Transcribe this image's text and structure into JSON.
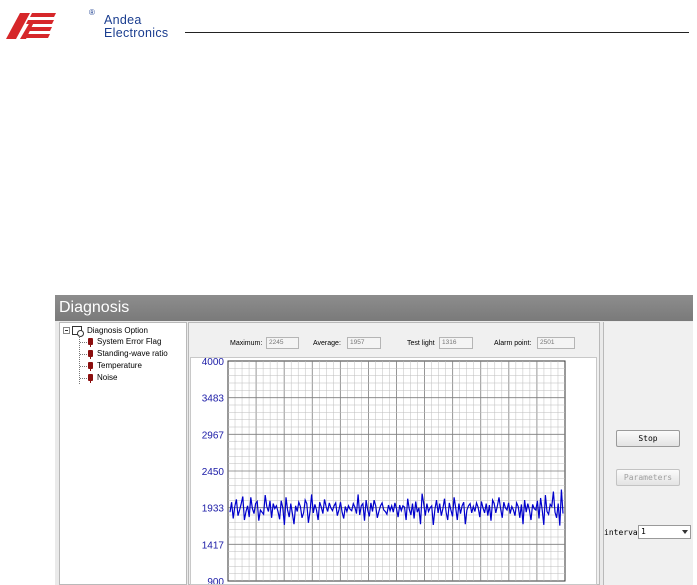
{
  "brand": {
    "line1": "Andea",
    "line2": "Electronics",
    "registered_mark": "®",
    "logo_color": "#d6272a",
    "text_color": "#1a3d8f"
  },
  "window": {
    "title": "Diagnosis"
  },
  "tree": {
    "root_label": "Diagnosis Option",
    "items": [
      {
        "label": "System Error Flag",
        "icon": "red-pin-icon"
      },
      {
        "label": "Standing-wave ratio",
        "icon": "red-pin-icon"
      },
      {
        "label": "Temperature",
        "icon": "red-pin-icon"
      },
      {
        "label": "Noise",
        "icon": "red-pin-icon"
      }
    ]
  },
  "stats": {
    "maximum_label": "Maximum:",
    "maximum_value": "2245",
    "average_label": "Average:",
    "average_value": "1957",
    "test_light_label": "Test light",
    "test_light_value": "1316",
    "alarm_point_label": "Alarm point:",
    "alarm_point_value": "2501"
  },
  "controls": {
    "stop_label": "Stop",
    "parameters_label": "Parameters",
    "interval_label": "interval",
    "interval_value": "1"
  },
  "chart_data": {
    "type": "line",
    "title": "",
    "xlabel": "",
    "ylabel": "",
    "ylim": [
      900,
      4000
    ],
    "y_ticks": [
      "4000",
      "3483",
      "2967",
      "2450",
      "1933",
      "1417",
      "900"
    ],
    "grid": true,
    "line_color": "#0000cc",
    "axis_label_color": "#1a1aa6",
    "series": [
      {
        "values": [
          1870,
          2010,
          1780,
          1950,
          2050,
          1820,
          1900,
          1990,
          2090,
          1760,
          1880,
          1960,
          1800,
          2080,
          1920,
          1850,
          1990,
          2020,
          1750,
          1900,
          1870,
          1840,
          2110,
          1950,
          1880,
          2030,
          1790,
          1990,
          1920,
          1960,
          1880,
          1770,
          2030,
          1930,
          1690,
          2080,
          1900,
          1800,
          1990,
          1850,
          1700,
          1960,
          1880,
          2010,
          1950,
          1790,
          1860,
          2040,
          1990,
          1720,
          1880,
          2120,
          1860,
          1980,
          1900,
          1760,
          2010,
          1940,
          1850,
          2050,
          1950,
          1880,
          2000,
          1930,
          1890,
          1960,
          2000,
          1820,
          1900,
          2010,
          1870,
          1780,
          1950,
          1880,
          1960,
          1910,
          1890,
          1990,
          1940,
          1850,
          2120,
          1830,
          1960,
          1990,
          1750,
          2040,
          1900,
          1810,
          2000,
          1880,
          2040,
          1960,
          1790,
          1880,
          1960,
          2000,
          1900,
          1880,
          1840,
          1970,
          1890,
          1960,
          1870,
          2000,
          1920,
          1800,
          1970,
          1890,
          1960,
          1940,
          1760,
          2060,
          1910,
          1830,
          1990,
          1780,
          2020,
          1870,
          1930,
          1700,
          2130,
          1990,
          1820,
          1990,
          1880,
          1930,
          1960,
          1690,
          1910,
          2040,
          1860,
          1990,
          1820,
          1920,
          2060,
          1870,
          1760,
          2000,
          1900,
          1810,
          2080,
          1930,
          1760,
          1990,
          1850,
          1960,
          2010,
          1700,
          1900,
          1960,
          1990,
          1860,
          1950,
          1880,
          2000,
          1940,
          1800,
          2020,
          1930,
          1860,
          1990,
          1820,
          1970,
          1750,
          2040,
          1990,
          1860,
          1960,
          2080,
          1920,
          1790,
          2010,
          1930,
          1900,
          2000,
          1850,
          1950,
          1900,
          1820,
          2000,
          1950,
          1790,
          1980,
          1700,
          2040,
          1870,
          1990,
          1900,
          1760,
          1980,
          1920,
          1900,
          2030,
          1780,
          2070,
          1900,
          1690,
          2110,
          1880,
          1840,
          1980,
          1950,
          2160,
          1870,
          1790,
          1990,
          1680,
          2190,
          1850
        ]
      }
    ]
  }
}
